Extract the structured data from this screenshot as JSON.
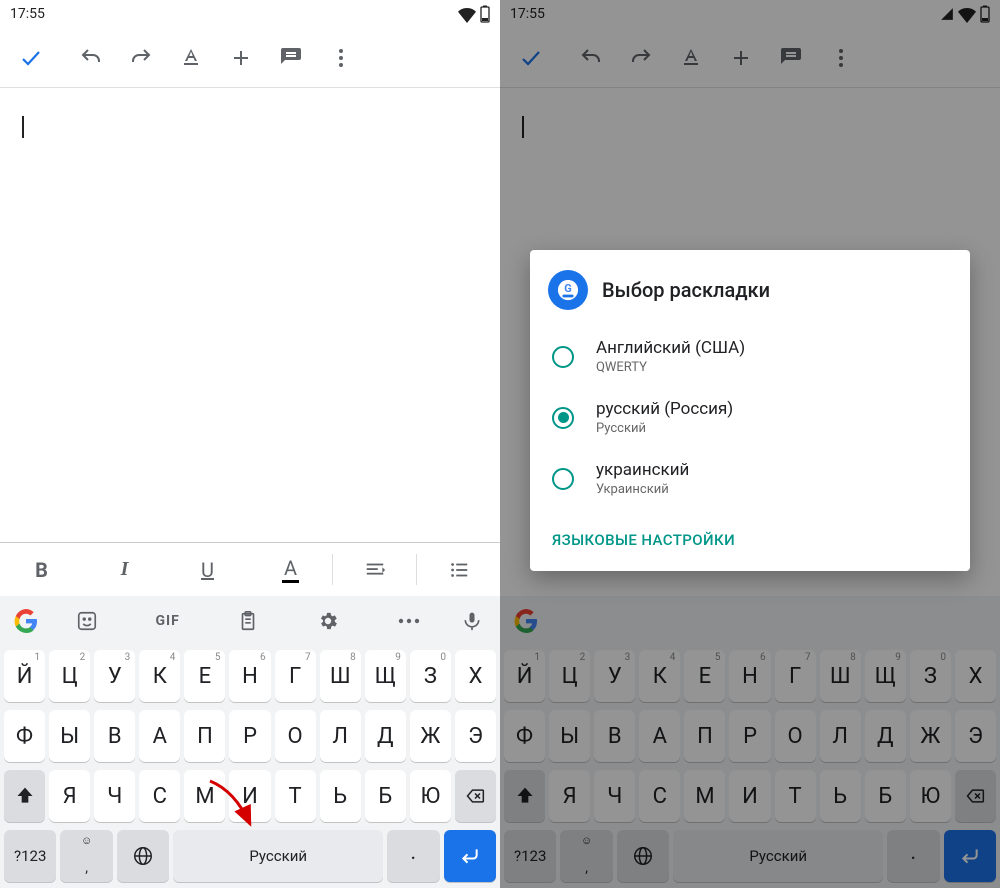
{
  "status": {
    "time": "17:55"
  },
  "editor": {
    "placeholder_cursor": "I"
  },
  "format_bar": {
    "bold": "B",
    "italic": "I",
    "underline": "U",
    "textcolor": "A"
  },
  "suggest_bar": {
    "gif": "GIF"
  },
  "keyboard": {
    "row1": [
      {
        "ch": "Й",
        "hint": "1"
      },
      {
        "ch": "Ц",
        "hint": "2"
      },
      {
        "ch": "У",
        "hint": "3"
      },
      {
        "ch": "К",
        "hint": "4"
      },
      {
        "ch": "Е",
        "hint": "5"
      },
      {
        "ch": "Н",
        "hint": "6"
      },
      {
        "ch": "Г",
        "hint": "7"
      },
      {
        "ch": "Ш",
        "hint": "8"
      },
      {
        "ch": "Щ",
        "hint": "9"
      },
      {
        "ch": "З",
        "hint": "0"
      },
      {
        "ch": "Х",
        "hint": ""
      }
    ],
    "row2": [
      "Ф",
      "Ы",
      "В",
      "А",
      "П",
      "Р",
      "О",
      "Л",
      "Д",
      "Ж",
      "Э"
    ],
    "row3": [
      "Я",
      "Ч",
      "С",
      "М",
      "И",
      "Т",
      "Ь",
      "Б",
      "Ю"
    ],
    "symbols": "?123",
    "comma": ",",
    "period": ".",
    "space_label": "Русский"
  },
  "dialog": {
    "title": "Выбор раскладки",
    "options": [
      {
        "label": "Английский (США)",
        "sub": "QWERTY",
        "selected": false
      },
      {
        "label": "русский (Россия)",
        "sub": "Русский",
        "selected": true
      },
      {
        "label": "украинский",
        "sub": "Украинский",
        "selected": false
      }
    ],
    "action": "ЯЗЫКОВЫЕ НАСТРОЙКИ"
  }
}
